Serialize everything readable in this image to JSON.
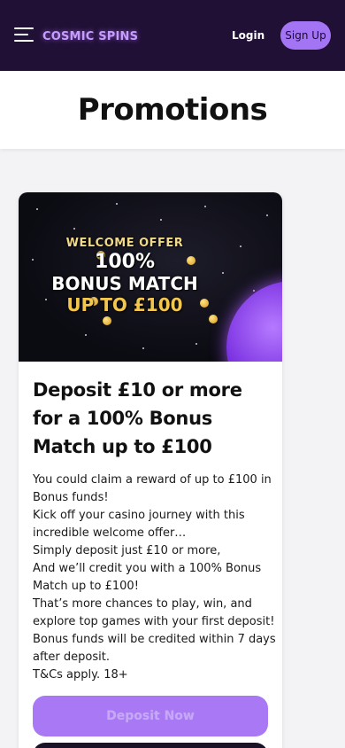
{
  "header": {
    "logo": "COSMIC SPINS",
    "login_label": "Login",
    "signup_label": "Sign Up",
    "bg_color": "#211036",
    "accent_color": "#a374f4"
  },
  "page": {
    "title": "Promotions"
  },
  "promo": {
    "banner": {
      "welcome": "WELCOME OFFER",
      "percent": "100%",
      "match": "BONUS MATCH",
      "upto": "UP TO £100"
    },
    "heading": "Deposit £10 or more for a 100% Bonus Match up to £100",
    "description_lines": [
      "You could claim a reward of up to £100 in",
      "Bonus funds!",
      "Kick off your casino journey with this",
      "incredible welcome offer…",
      "Simply deposit just £10 or more,",
      "And we’ll credit you with a 100% Bonus",
      "Match up to £100!",
      "That’s more chances to play, win, and",
      "explore top games with your first deposit!",
      "Bonus funds will be credited within 7 days",
      "after deposit.",
      "T&Cs apply. 18+"
    ],
    "cta_label": "Deposit Now"
  }
}
